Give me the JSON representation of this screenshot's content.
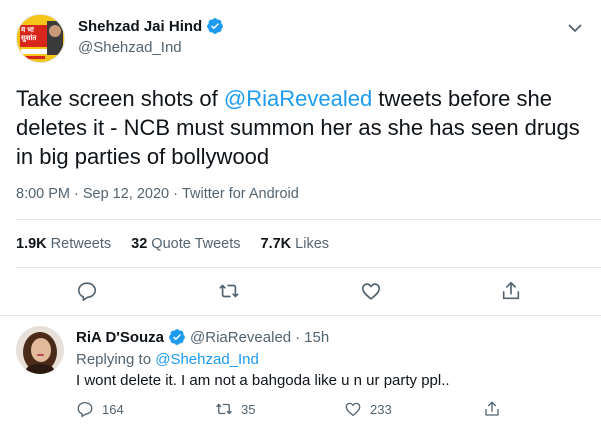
{
  "main_tweet": {
    "author": {
      "display_name": "Shehzad Jai Hind",
      "handle": "@Shehzad_Ind",
      "avatar_text": "मैं भी सुशांत"
    },
    "text_before": "Take screen shots of ",
    "mention": "@RiaRevealed",
    "text_after": " tweets before she deletes it - NCB must summon her as she has seen drugs in big parties of bollywood",
    "time": "8:00 PM",
    "date": "Sep 12, 2020",
    "source": "Twitter for Android",
    "stats": {
      "retweets_count": "1.9K",
      "retweets_label": "Retweets",
      "quotes_count": "32",
      "quotes_label": "Quote Tweets",
      "likes_count": "7.7K",
      "likes_label": "Likes"
    }
  },
  "reply_tweet": {
    "author": {
      "display_name": "RiA D'Souza",
      "handle": "@RiaRevealed",
      "time": "15h"
    },
    "replying_prefix": "Replying to ",
    "replying_to": "@Shehzad_Ind",
    "text": "I wont delete it. I am not a bahgoda like u n ur party ppl..",
    "counts": {
      "replies": "164",
      "retweets": "35",
      "likes": "233"
    }
  },
  "colors": {
    "accent": "#1d9bf0",
    "secondary_text": "#536471",
    "divider": "#e1e8ed"
  }
}
